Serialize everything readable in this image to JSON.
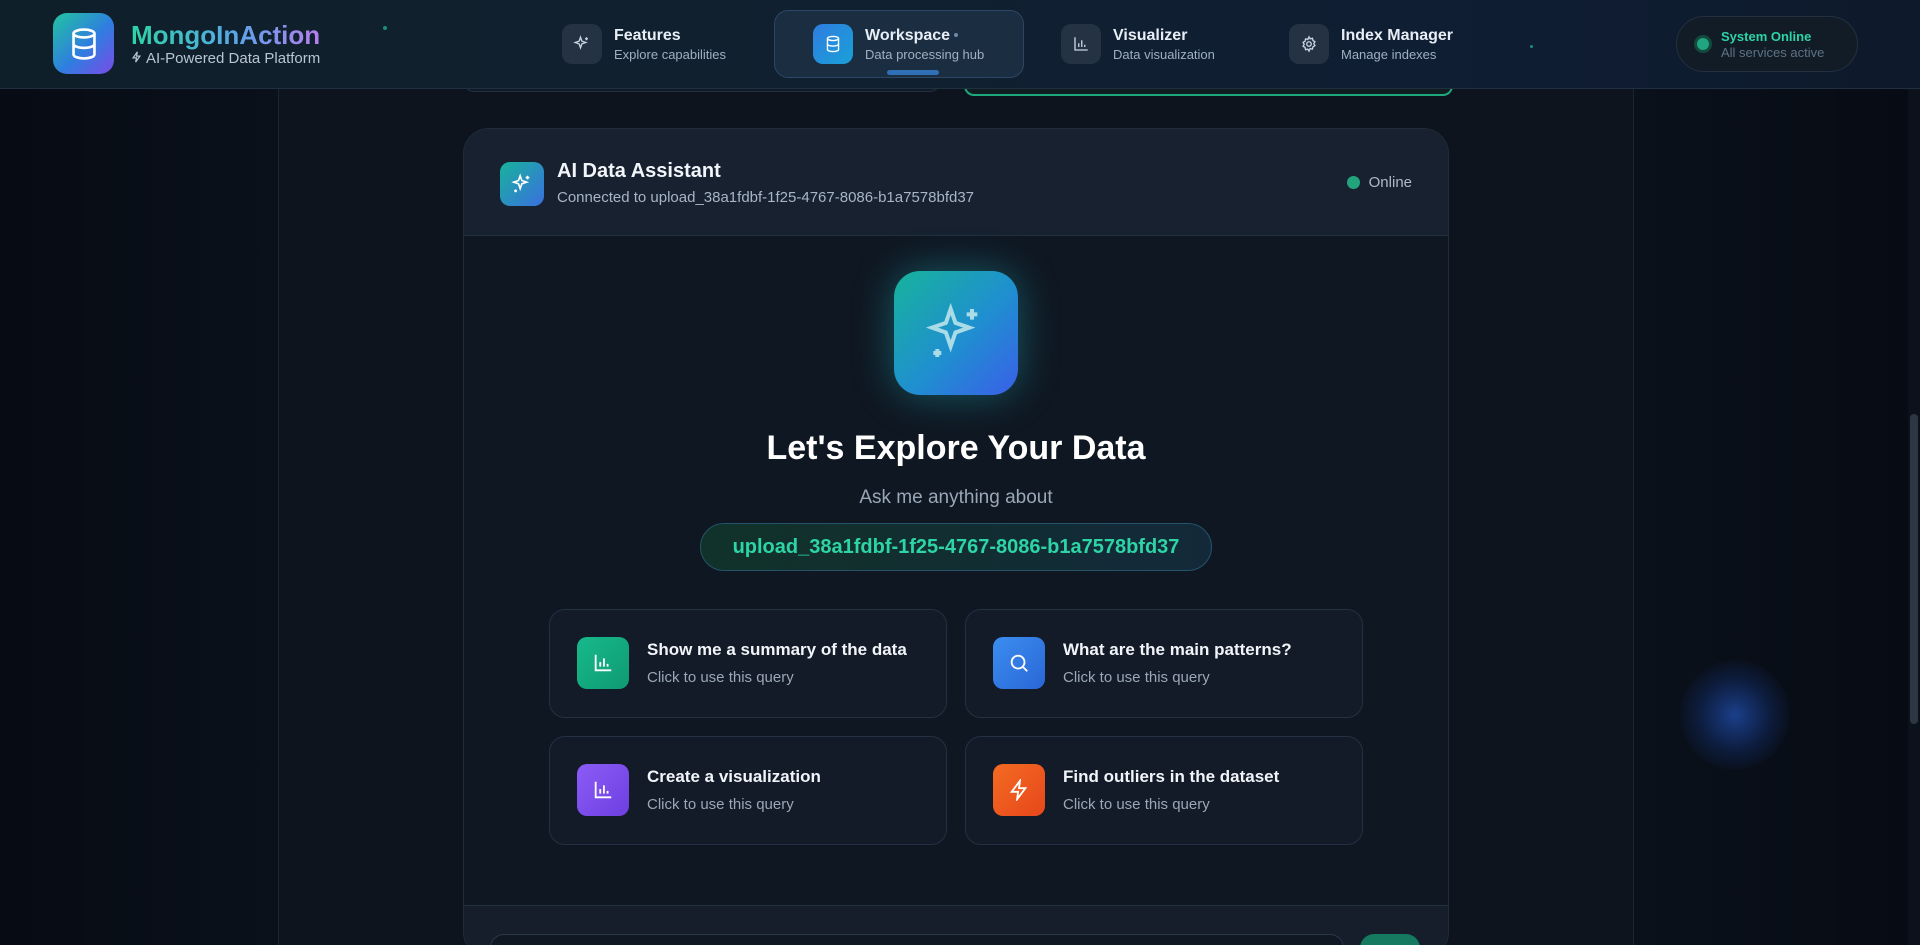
{
  "header": {
    "brand_title": "MongoInAction",
    "brand_subtitle": "AI-Powered Data Platform",
    "nav": [
      {
        "title": "Features",
        "subtitle": "Explore capabilities",
        "icon": "sparkles-icon"
      },
      {
        "title": "Workspace",
        "subtitle": "Data processing hub",
        "icon": "database-icon",
        "active": true
      },
      {
        "title": "Visualizer",
        "subtitle": "Data visualization",
        "icon": "bar-chart-icon"
      },
      {
        "title": "Index Manager",
        "subtitle": "Manage indexes",
        "icon": "gear-icon"
      }
    ],
    "status": {
      "title": "System Online",
      "subtitle": "All services active"
    }
  },
  "assistant": {
    "title": "AI Data Assistant",
    "connection": "Connected to upload_38a1fdbf-1f25-4767-8086-b1a7578bfd37",
    "status": "Online",
    "hero_title": "Let's Explore Your Data",
    "hero_subtitle": "Ask me anything about",
    "dataset": "upload_38a1fdbf-1f25-4767-8086-b1a7578bfd37",
    "queries": [
      {
        "title": "Show me a summary of the data",
        "subtitle": "Click to use this query",
        "icon": "bar-chart-icon",
        "color": "#14a87f"
      },
      {
        "title": "What are the main patterns?",
        "subtitle": "Click to use this query",
        "icon": "search-icon",
        "color": "#2f7de0"
      },
      {
        "title": "Create a visualization",
        "subtitle": "Click to use this query",
        "icon": "bar-chart-icon",
        "color": "#7b4be8"
      },
      {
        "title": "Find outliers in the dataset",
        "subtitle": "Click to use this query",
        "icon": "lightning-icon",
        "color": "#f0561c"
      }
    ]
  },
  "colors": {
    "accent_green": "#2dd4a6",
    "accent_blue": "#2f7de0",
    "background": "#0d141e"
  }
}
